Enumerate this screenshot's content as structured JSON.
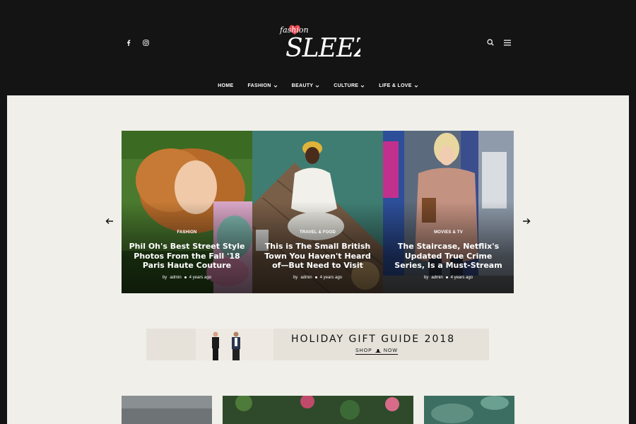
{
  "brand": {
    "script_word": "fashion",
    "main_word": "SLEEZY"
  },
  "header": {
    "social_icons": [
      "facebook-icon",
      "instagram-icon"
    ],
    "tool_icons": [
      "search-icon",
      "menu-icon"
    ]
  },
  "nav": {
    "items": [
      {
        "label": "HOME",
        "has_dropdown": false
      },
      {
        "label": "FASHION",
        "has_dropdown": true
      },
      {
        "label": "BEAUTY",
        "has_dropdown": true
      },
      {
        "label": "CULTURE",
        "has_dropdown": true
      },
      {
        "label": "LIFE & LOVE",
        "has_dropdown": true
      }
    ]
  },
  "slider": {
    "slides": [
      {
        "category": "FASHION",
        "title": "Phil Oh's Best Street Style Photos From the Fall '18 Paris Haute Couture",
        "by": "by",
        "author": "admin",
        "date": "4 years ago"
      },
      {
        "category": "TRAVEL & FOOD",
        "title": "This is The Small British Town You Haven't Heard of—But Need to Visit",
        "by": "by",
        "author": "admin",
        "date": "4 years ago"
      },
      {
        "category": "MOVIES & TV",
        "title": "The Staircase, Netflix's Updated True Crime Series, Is a Must-Stream",
        "by": "by",
        "author": "admin",
        "date": "4 years ago"
      }
    ],
    "prev_icon": "arrow-left-icon",
    "next_icon": "arrow-right-icon"
  },
  "banner": {
    "title": "HOLIDAY GIFT GUIDE 2018",
    "cta_left": "SHOP",
    "cta_right": "NOW"
  },
  "colors": {
    "header_bg": "#141414",
    "content_bg": "#f0efea",
    "banner_bg": "#e6e2da",
    "logo_heart": "#e8454f"
  }
}
